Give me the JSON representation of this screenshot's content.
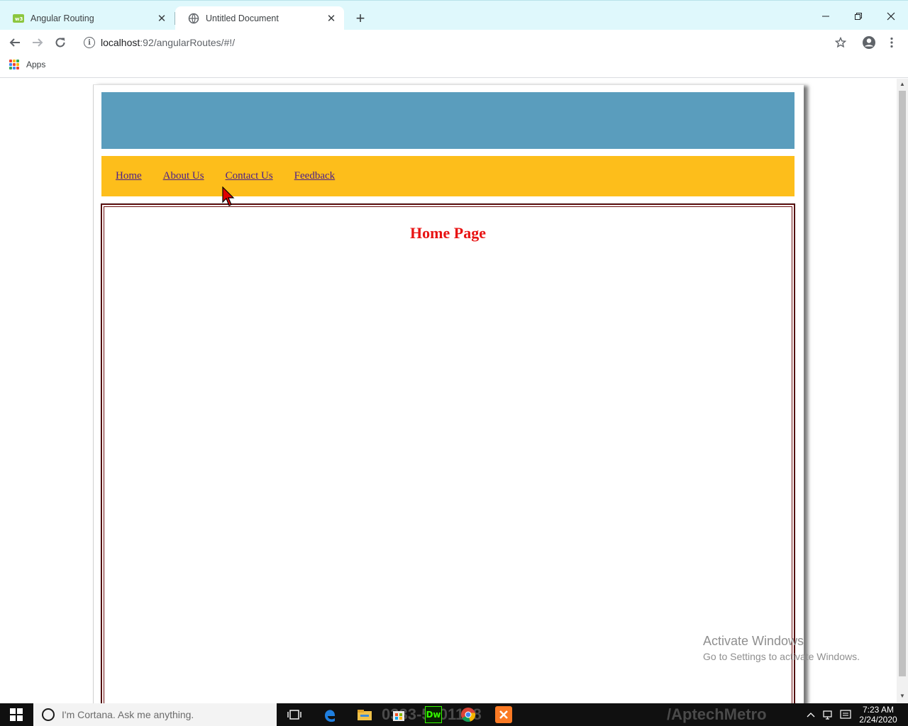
{
  "browser": {
    "tabs": [
      {
        "title": "Angular Routing",
        "active": false
      },
      {
        "title": "Untitled Document",
        "active": true
      }
    ],
    "new_tab_label": "+",
    "url_host": "localhost",
    "url_path": ":92/angularRoutes/#!/",
    "bookmarks": {
      "apps_label": "Apps"
    }
  },
  "page": {
    "nav_links": [
      "Home",
      "About Us",
      "Contact Us",
      "Feedback"
    ],
    "heading": "Home Page",
    "colors": {
      "header_band": "#5a9dbd",
      "nav_band": "#fdbe1b",
      "link": "#4b1f8a",
      "heading": "#e81414",
      "frame_border": "#6b0f0f"
    }
  },
  "watermark": {
    "line1": "Activate Windows",
    "line2": "Go to Settings to activate Windows."
  },
  "overlays": {
    "phone": "0333-5601188",
    "brand": "/AptechMetro"
  },
  "taskbar": {
    "search_placeholder": "I'm Cortana. Ask me anything.",
    "time": "7:23 AM",
    "date": "2/24/2020",
    "apps": [
      "task-view",
      "edge",
      "file-explorer",
      "store",
      "dreamweaver",
      "chrome",
      "xampp"
    ]
  }
}
